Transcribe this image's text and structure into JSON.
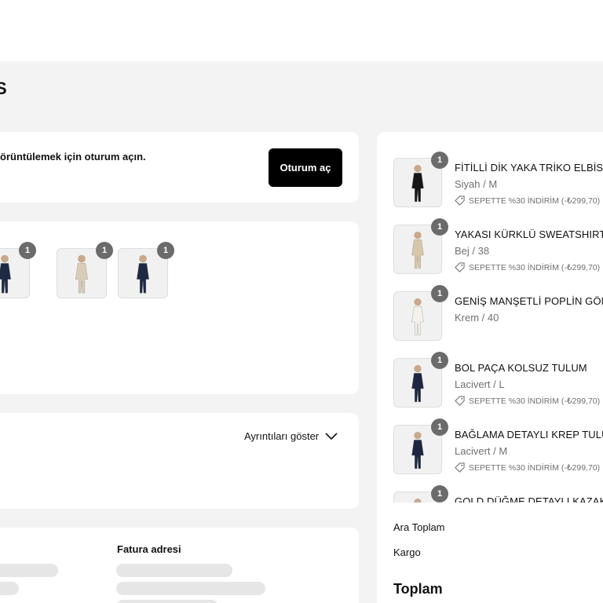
{
  "page": {
    "heading": "S"
  },
  "login": {
    "text": "örüntülemek için oturum açın.",
    "button_label": "Oturum aç"
  },
  "cart_thumbs": [
    {
      "qty": "1",
      "color": "#1e2a44"
    },
    {
      "qty": "1",
      "color": "#d9cdb8"
    },
    {
      "qty": "1",
      "color": "#1e2a44"
    }
  ],
  "details": {
    "toggle_label": "Ayrıntıları göster"
  },
  "address": {
    "billing_label": "Fatura adresi"
  },
  "summary": {
    "items": [
      {
        "name": "FİTİLLİ DİK YAKA TRİKO ELBİSE",
        "variant": "Siyah / M",
        "discount": "SEPETTE %30 İNDİRİM (-₺299,70)",
        "qty": "1",
        "color": "#161616"
      },
      {
        "name": "YAKASI KÜRKLÜ SWEATSHIRT",
        "variant": "Bej / 38",
        "discount": "SEPETTE %30 İNDİRİM (-₺299,70)",
        "qty": "1",
        "color": "#d7c7a9"
      },
      {
        "name": "GENİŞ MANŞETLİ POPLİN GÖMLEK",
        "variant": "Krem / 40",
        "discount": "",
        "qty": "1",
        "color": "#f4f1ea"
      },
      {
        "name": "BOL PAÇA KOLSUZ TULUM",
        "variant": "Lacivert / L",
        "discount": "SEPETTE %30 İNDİRİM (-₺299,70)",
        "qty": "1",
        "color": "#1c2640"
      },
      {
        "name": "BAĞLAMA DETAYLI KREP TULUM",
        "variant": "Lacivert / M",
        "discount": "SEPETTE %30 İNDİRİM (-₺299,70)",
        "qty": "1",
        "color": "#1c2640"
      },
      {
        "name": "GOLD DÜĞME DETAYLI KAZAK",
        "variant": "",
        "discount": "",
        "qty": "1",
        "color": "#d8d0c4"
      }
    ],
    "subtotal_label": "Ara Toplam",
    "shipping_label": "Kargo",
    "total_label": "Toplam"
  }
}
